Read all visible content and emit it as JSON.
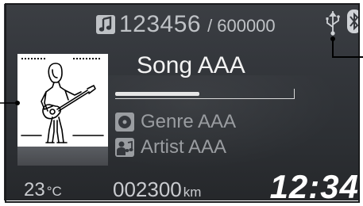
{
  "header": {
    "track_number": "123456",
    "separator": "/",
    "track_total": "600000",
    "icons": [
      "music-note-icon",
      "usb-icon",
      "bluetooth-icon"
    ]
  },
  "now_playing": {
    "song_title": "Song AAA",
    "progress": 0.47,
    "genre": "Genre AAA",
    "artist": "Artist AAA",
    "album_art": "guitarist-illustration"
  },
  "status_bar": {
    "temperature_value": "23",
    "temperature_unit": "°C",
    "odometer_value": "002300",
    "odometer_unit": "km",
    "clock": "12:34"
  },
  "colors": {
    "screen_bg": "#34373c",
    "primary_text": "#f3f3f3",
    "secondary_text": "#9a9da1",
    "callout_line": "#000000"
  }
}
